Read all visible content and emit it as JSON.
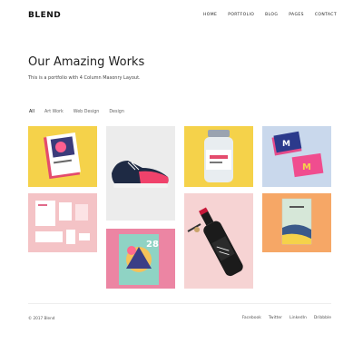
{
  "header": {
    "logo": "BLEND",
    "nav": [
      "HOME",
      "PORTFOLIO",
      "BLOG",
      "PAGES",
      "CONTACT"
    ]
  },
  "main": {
    "title": "Our Amazing Works",
    "subtitle": "This is a portfolio with 4 Column Masonry Layout."
  },
  "filters": [
    "All",
    "Art Work",
    "Web Design",
    "Design"
  ],
  "active_filter": "All",
  "portfolio": {
    "tiles": [
      {
        "subject": "magazine",
        "background": "#f5d24a"
      },
      {
        "subject": "sneaker",
        "background": "#ececec"
      },
      {
        "subject": "jar",
        "background": "#f5d24a"
      },
      {
        "subject": "business-cards",
        "background": "#c9d8ec"
      },
      {
        "subject": "stationery",
        "background": "#f4c3c6"
      },
      {
        "subject": "wine-bottle",
        "background": "#f6d3d3"
      },
      {
        "subject": "notebook",
        "background": "#f6a766"
      },
      {
        "subject": "poster",
        "background": "#ec85a3"
      }
    ]
  },
  "footer": {
    "copyright": "© 2017 Blend",
    "social": [
      "Facebook",
      "Twitter",
      "LinkedIn",
      "Dribbble"
    ]
  }
}
